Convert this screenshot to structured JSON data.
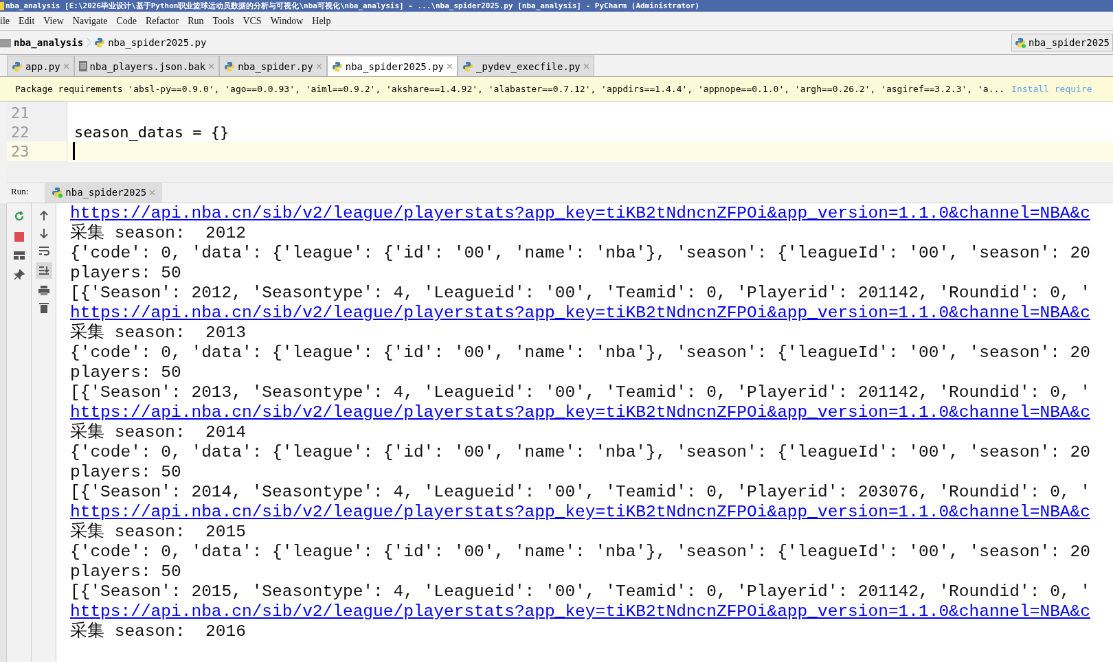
{
  "window": {
    "title": "nba_analysis [E:\\2026毕业设计\\基于Python职业篮球运动员数据的分析与可视化\\nba可视化\\nba_analysis] - ...\\nba_spider2025.py [nba_analysis] - PyCharm (Administrator)"
  },
  "menu": [
    "ile",
    "Edit",
    "View",
    "Navigate",
    "Code",
    "Refactor",
    "Run",
    "Tools",
    "VCS",
    "Window",
    "Help"
  ],
  "breadcrumb": {
    "project": "nba_analysis",
    "file": "nba_spider2025.py"
  },
  "run_config": "nba_spider2025",
  "tabs": [
    {
      "label": "app.py",
      "kind": "python",
      "selected": false
    },
    {
      "label": "nba_players.json.bak",
      "kind": "text",
      "selected": false
    },
    {
      "label": "nba_spider.py",
      "kind": "python",
      "selected": false
    },
    {
      "label": "nba_spider2025.py",
      "kind": "python",
      "selected": true
    },
    {
      "label": "_pydev_execfile.py",
      "kind": "python",
      "selected": false
    }
  ],
  "banner": {
    "text": "Package requirements 'absl-py==0.9.0', 'ago==0.0.93', 'aiml==0.9.2', 'akshare==1.4.92', 'alabaster==0.7.12', 'appdirs==1.4.4', 'appnope==0.1.0', 'argh==0.26.2', 'asgiref==3.2.3', 'a...",
    "link": "Install require"
  },
  "editor": {
    "lines": [
      {
        "number": "21",
        "current": false
      },
      {
        "number": "22",
        "code": "season_datas = {}",
        "current": false
      },
      {
        "number": "23",
        "current": true
      }
    ]
  },
  "run": {
    "label": "Run:",
    "tab": "nba_spider2025",
    "lines": [
      {
        "kind": "url",
        "text": "https://api.nba.cn/sib/v2/league/playerstats?app_key=tiKB2tNdncnZFPOi&app_version=1.1.0&channel=NBA&c"
      },
      {
        "kind": "text",
        "text": "采集 season:  2012"
      },
      {
        "kind": "text",
        "text": "{'code': 0, 'data': {'league': {'id': '00', 'name': 'nba'}, 'season': {'leagueId': '00', 'season': 20"
      },
      {
        "kind": "text",
        "text": "players: 50"
      },
      {
        "kind": "text",
        "text": "[{'Season': 2012, 'Seasontype': 4, 'Leagueid': '00', 'Teamid': 0, 'Playerid': 201142, 'Roundid': 0, '"
      },
      {
        "kind": "url",
        "text": "https://api.nba.cn/sib/v2/league/playerstats?app_key=tiKB2tNdncnZFPOi&app_version=1.1.0&channel=NBA&c"
      },
      {
        "kind": "text",
        "text": "采集 season:  2013"
      },
      {
        "kind": "text",
        "text": "{'code': 0, 'data': {'league': {'id': '00', 'name': 'nba'}, 'season': {'leagueId': '00', 'season': 20"
      },
      {
        "kind": "text",
        "text": "players: 50"
      },
      {
        "kind": "text",
        "text": "[{'Season': 2013, 'Seasontype': 4, 'Leagueid': '00', 'Teamid': 0, 'Playerid': 201142, 'Roundid': 0, '"
      },
      {
        "kind": "url",
        "text": "https://api.nba.cn/sib/v2/league/playerstats?app_key=tiKB2tNdncnZFPOi&app_version=1.1.0&channel=NBA&c"
      },
      {
        "kind": "text",
        "text": "采集 season:  2014"
      },
      {
        "kind": "text",
        "text": "{'code': 0, 'data': {'league': {'id': '00', 'name': 'nba'}, 'season': {'leagueId': '00', 'season': 20"
      },
      {
        "kind": "text",
        "text": "players: 50"
      },
      {
        "kind": "text",
        "text": "[{'Season': 2014, 'Seasontype': 4, 'Leagueid': '00', 'Teamid': 0, 'Playerid': 203076, 'Roundid': 0, '"
      },
      {
        "kind": "url",
        "text": "https://api.nba.cn/sib/v2/league/playerstats?app_key=tiKB2tNdncnZFPOi&app_version=1.1.0&channel=NBA&c"
      },
      {
        "kind": "text",
        "text": "采集 season:  2015"
      },
      {
        "kind": "text",
        "text": "{'code': 0, 'data': {'league': {'id': '00', 'name': 'nba'}, 'season': {'leagueId': '00', 'season': 20"
      },
      {
        "kind": "text",
        "text": "players: 50"
      },
      {
        "kind": "text",
        "text": "[{'Season': 2015, 'Seasontype': 4, 'Leagueid': '00', 'Teamid': 0, 'Playerid': 201142, 'Roundid': 0, '"
      },
      {
        "kind": "url",
        "text": "https://api.nba.cn/sib/v2/league/playerstats?app_key=tiKB2tNdncnZFPOi&app_version=1.1.0&channel=NBA&c"
      },
      {
        "kind": "text",
        "text": "采集 season:  2016"
      }
    ]
  }
}
